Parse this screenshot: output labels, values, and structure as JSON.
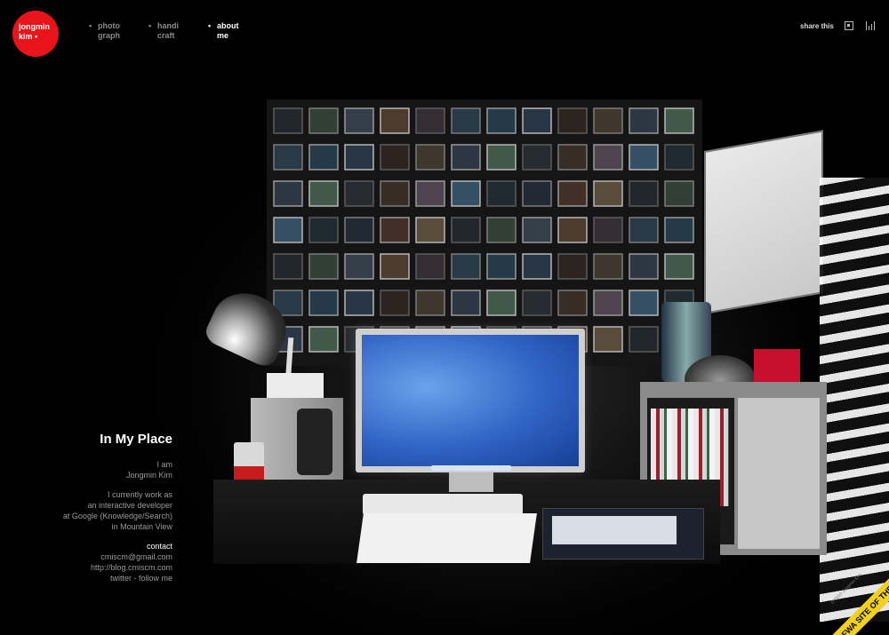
{
  "logo": {
    "line1": "jongmin",
    "line2": "kim •"
  },
  "nav": [
    {
      "line1": "photo",
      "line2": "graph",
      "active": false
    },
    {
      "line1": "handi",
      "line2": "craft",
      "active": false
    },
    {
      "line1": "about",
      "line2": "me",
      "active": true
    }
  ],
  "header": {
    "share_label": "share this",
    "icon1": "square-dot-icon",
    "icon2": "bar-chart-icon"
  },
  "about": {
    "title": "In My Place",
    "intro": [
      "I am",
      "Jongmin Kim"
    ],
    "work": [
      "I currently work as",
      "an interactive developer",
      "at Google (Knowledge/Search)",
      "in Mountain View"
    ],
    "contact_label": "contact",
    "contact": [
      "cmiscm@gmail.com",
      "http://blog.cmiscm.com",
      "twitter - follow me"
    ]
  },
  "badge": {
    "ribbon": "FWA SITE OF THE DAY",
    "copyright": "© 2010 Jongmin Kim"
  },
  "colors": {
    "accent": "#e8141a",
    "badge": "#f2d11a",
    "background": "#000000"
  }
}
